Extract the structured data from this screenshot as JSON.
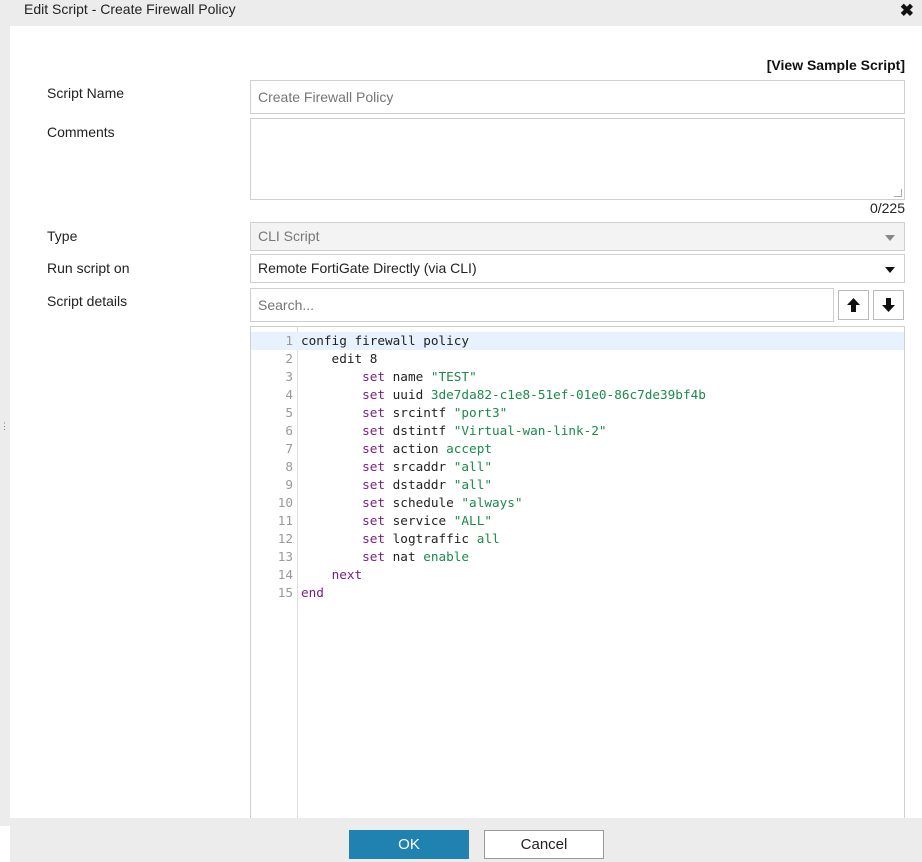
{
  "dialog": {
    "title": "Edit Script - Create Firewall Policy",
    "close_icon": "close-icon"
  },
  "view_sample_label": "[View Sample Script]",
  "labels": {
    "script_name": "Script Name",
    "comments": "Comments",
    "type": "Type",
    "run_script_on": "Run script on",
    "script_details": "Script details"
  },
  "script_name": {
    "value": "",
    "placeholder": "Create Firewall Policy"
  },
  "comments": {
    "value": "",
    "counter": "0/225"
  },
  "type": {
    "selected": "CLI Script"
  },
  "run_script_on": {
    "selected": "Remote FortiGate Directly (via CLI)"
  },
  "search": {
    "placeholder": "Search..."
  },
  "nav_icons": [
    "arrow-up-icon",
    "arrow-down-icon"
  ],
  "code": {
    "line_numbers": [
      "1",
      "2",
      "3",
      "4",
      "5",
      "6",
      "7",
      "8",
      "9",
      "10",
      "11",
      "12",
      "13",
      "14",
      "15"
    ],
    "lines": [
      [
        {
          "t": "config firewall policy",
          "c": ""
        }
      ],
      [
        {
          "t": "    edit 8",
          "c": ""
        }
      ],
      [
        {
          "t": "        ",
          "c": ""
        },
        {
          "t": "set",
          "c": "k"
        },
        {
          "t": " name ",
          "c": ""
        },
        {
          "t": "\"TEST\"",
          "c": "s"
        }
      ],
      [
        {
          "t": "        ",
          "c": ""
        },
        {
          "t": "set",
          "c": "k"
        },
        {
          "t": " uuid ",
          "c": ""
        },
        {
          "t": "3de7da82-c1e8-51ef-01e0-86c7de39bf4b",
          "c": "v"
        }
      ],
      [
        {
          "t": "        ",
          "c": ""
        },
        {
          "t": "set",
          "c": "k"
        },
        {
          "t": " srcintf ",
          "c": ""
        },
        {
          "t": "\"port3\"",
          "c": "s"
        }
      ],
      [
        {
          "t": "        ",
          "c": ""
        },
        {
          "t": "set",
          "c": "k"
        },
        {
          "t": " dstintf ",
          "c": ""
        },
        {
          "t": "\"Virtual-wan-link-2\"",
          "c": "s"
        }
      ],
      [
        {
          "t": "        ",
          "c": ""
        },
        {
          "t": "set",
          "c": "k"
        },
        {
          "t": " action ",
          "c": ""
        },
        {
          "t": "accept",
          "c": "v"
        }
      ],
      [
        {
          "t": "        ",
          "c": ""
        },
        {
          "t": "set",
          "c": "k"
        },
        {
          "t": " srcaddr ",
          "c": ""
        },
        {
          "t": "\"all\"",
          "c": "s"
        }
      ],
      [
        {
          "t": "        ",
          "c": ""
        },
        {
          "t": "set",
          "c": "k"
        },
        {
          "t": " dstaddr ",
          "c": ""
        },
        {
          "t": "\"all\"",
          "c": "s"
        }
      ],
      [
        {
          "t": "        ",
          "c": ""
        },
        {
          "t": "set",
          "c": "k"
        },
        {
          "t": " schedule ",
          "c": ""
        },
        {
          "t": "\"always\"",
          "c": "s"
        }
      ],
      [
        {
          "t": "        ",
          "c": ""
        },
        {
          "t": "set",
          "c": "k"
        },
        {
          "t": " service ",
          "c": ""
        },
        {
          "t": "\"ALL\"",
          "c": "s"
        }
      ],
      [
        {
          "t": "        ",
          "c": ""
        },
        {
          "t": "set",
          "c": "k"
        },
        {
          "t": " logtraffic ",
          "c": ""
        },
        {
          "t": "all",
          "c": "v"
        }
      ],
      [
        {
          "t": "        ",
          "c": ""
        },
        {
          "t": "set",
          "c": "k"
        },
        {
          "t": " nat ",
          "c": ""
        },
        {
          "t": "enable",
          "c": "v"
        }
      ],
      [
        {
          "t": "    ",
          "c": ""
        },
        {
          "t": "next",
          "c": "k"
        }
      ],
      [
        {
          "t": "end",
          "c": "k"
        }
      ]
    ]
  },
  "footer": {
    "ok_label": "OK",
    "cancel_label": "Cancel"
  },
  "colors": {
    "primary": "#1f82b0",
    "keyword": "#7a1e86",
    "string": "#1b8a4c",
    "active_line": "#e8f2ff"
  }
}
